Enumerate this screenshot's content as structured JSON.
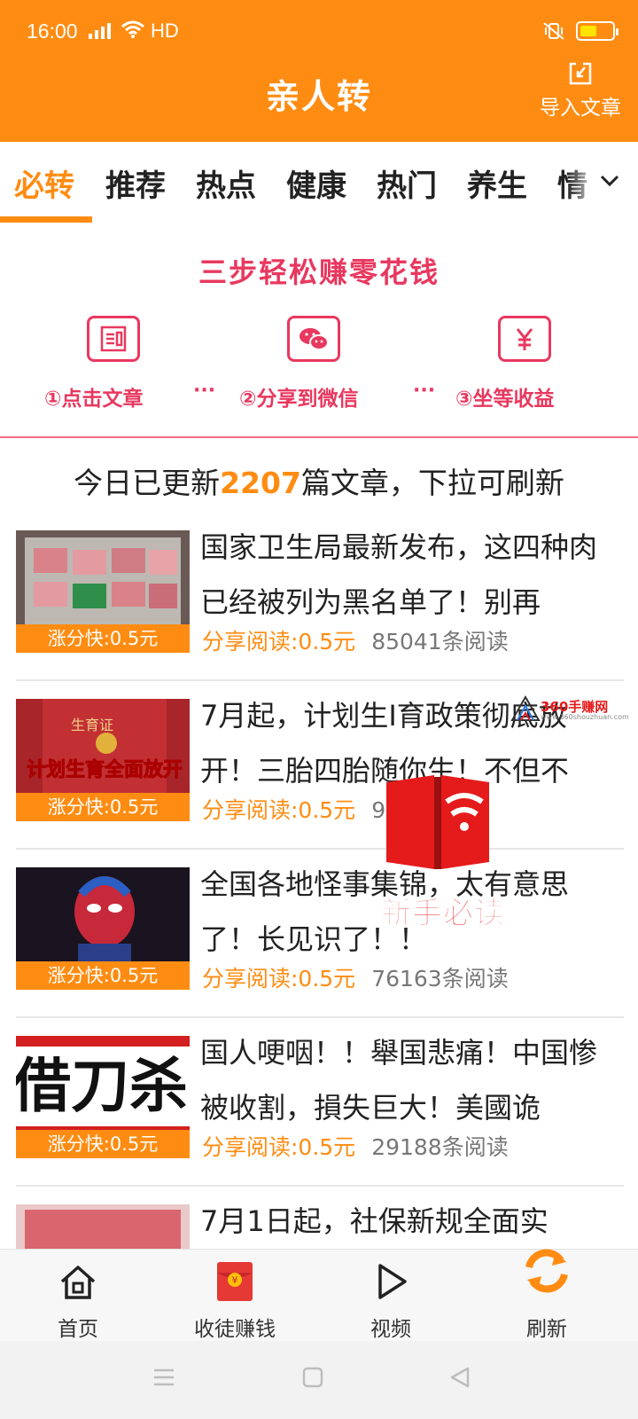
{
  "status_bar": {
    "time": "16:00",
    "network": "4G",
    "hd": "HD"
  },
  "header": {
    "title": "亲人转",
    "import_label": "导入文章"
  },
  "tabs": [
    "必转",
    "推荐",
    "热点",
    "健康",
    "热门",
    "养生",
    "情"
  ],
  "promo": {
    "title": "三步轻松赚零花钱",
    "steps": [
      "①点击文章",
      "②分享到微信",
      "③坐等收益"
    ],
    "separator": "···",
    "icon_names": [
      "article-icon",
      "wechat-icon",
      "yuan-icon"
    ]
  },
  "notice": {
    "prefix": "今日已更新",
    "count": "2207",
    "suffix": "篇文章，下拉可刷新"
  },
  "articles": [
    {
      "title": "国家卫生局最新发布，这四种肉已经被列为黑名单了！别再",
      "badge": "涨分快:0.5元",
      "share": "分享阅读:0.5元",
      "reads": "85041条阅读"
    },
    {
      "title": "7月起，计划生I育政策彻底放开！三胎四胎随你生！不但不",
      "badge": "涨分快:0.5元",
      "share": "分享阅读:0.5元",
      "reads": "9  条阅读",
      "thumb_text": "计划生育全面放开",
      "thumb_sub": "生育证"
    },
    {
      "title": "全国各地怪事集锦，太有意思了！长见识了！！",
      "badge": "涨分快:0.5元",
      "share": "分享阅读:0.5元",
      "reads": "76163条阅读"
    },
    {
      "title": "国人哽咽！！舉国悲痛！中国惨被收割，損失巨大！美國诡",
      "badge": "涨分快:0.5元",
      "share": "分享阅读:0.5元",
      "reads": "29188条阅读",
      "thumb_text": "借刀杀"
    },
    {
      "title": "7月1日起，社保新规全面实",
      "badge": "",
      "share": "",
      "reads": ""
    }
  ],
  "overlay": {
    "reader_label": "新手必读",
    "watermark": "360手赚网",
    "watermark_sub": "www.360shouzhuan.com"
  },
  "bottom_nav": [
    {
      "label": "首页",
      "icon": "home-icon"
    },
    {
      "label": "收徒赚钱",
      "icon": "red-envelope-icon"
    },
    {
      "label": "视频",
      "icon": "play-icon"
    },
    {
      "label": "刷新",
      "icon": "refresh-icon"
    }
  ],
  "colors": {
    "brand": "#FF8C12",
    "promo": "#E8385F",
    "accent_red": "#E51B1B"
  }
}
